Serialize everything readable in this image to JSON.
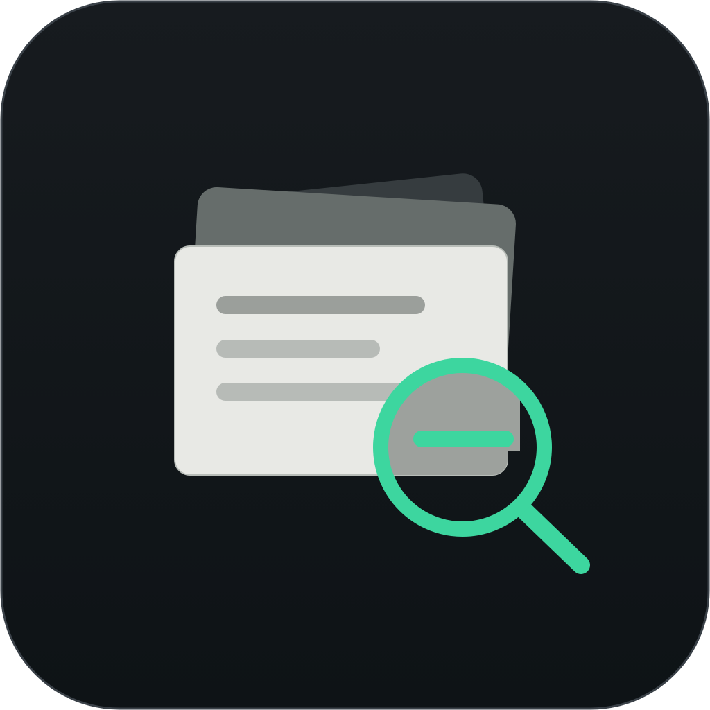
{
  "icon": {
    "name": "zoom-out-cards-icon",
    "description_visible_text": ""
  },
  "colors": {
    "tile_background_top": "#171B1F",
    "tile_background_bottom": "#0E1316",
    "tile_border": "#3A4148",
    "back_card": "#363C3F",
    "middle_card": "#666D6B",
    "front_card": "#E8E9E5",
    "front_card_border": "#B8BDB8",
    "text_line_dark": "#9B9F9B",
    "text_line_light": "#B7BBB7",
    "lens_fill": "#9DA19D",
    "accent_green": "#3DD69F"
  }
}
